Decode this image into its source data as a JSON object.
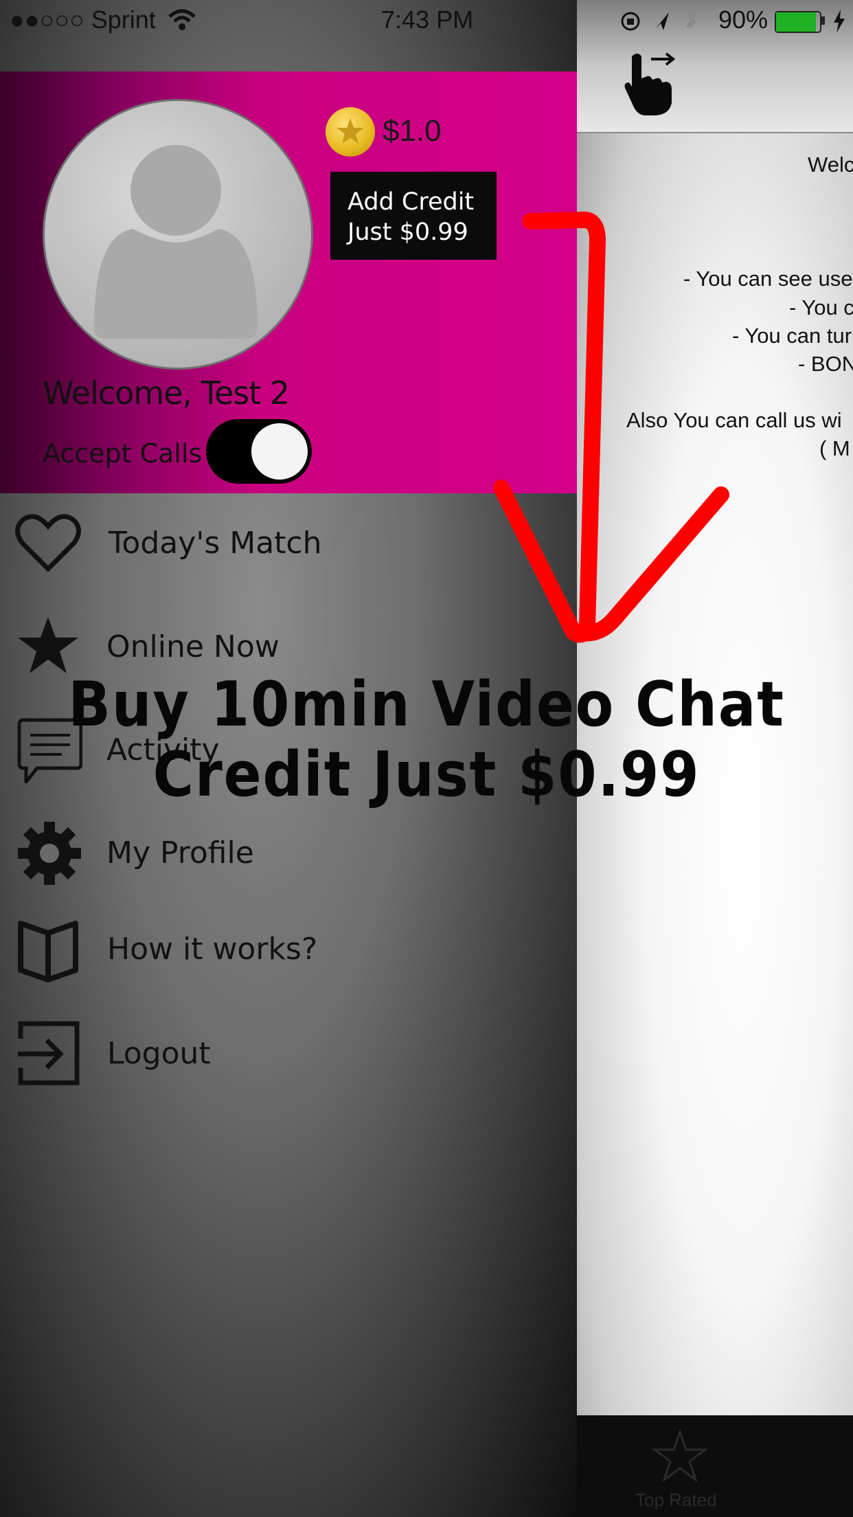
{
  "status_bar": {
    "carrier": "●●○○○ Sprint",
    "time": "7:43 PM",
    "battery_percent": "90%"
  },
  "drawer": {
    "credit_balance": "$1.0",
    "add_credit_label": "Add Credit\nJust $0.99",
    "welcome_text": "Welcome, Test 2",
    "accept_calls_label": "Accept Calls",
    "accept_calls_on": true,
    "menu": [
      {
        "label": "Today's Match",
        "icon": "heart-icon"
      },
      {
        "label": "Online Now",
        "icon": "star-icon"
      },
      {
        "label": "Activity",
        "icon": "chat-bubble-icon"
      },
      {
        "label": "My Profile",
        "icon": "gear-icon"
      },
      {
        "label": "How it works?",
        "icon": "book-icon"
      },
      {
        "label": "Logout",
        "icon": "logout-icon"
      }
    ]
  },
  "main": {
    "welcome_lines": [
      "Welc",
      "- You can see use",
      "- You c",
      "- You can tur",
      "- BON",
      "Also You can call us wi",
      "( M"
    ],
    "tab_label": "Top Rated"
  },
  "promo": {
    "line1": "Buy 10min Video Chat",
    "line2": "Credit Just $0.99"
  },
  "colors": {
    "drawer_header": "#d4008a",
    "arrow": "#ff0000"
  }
}
